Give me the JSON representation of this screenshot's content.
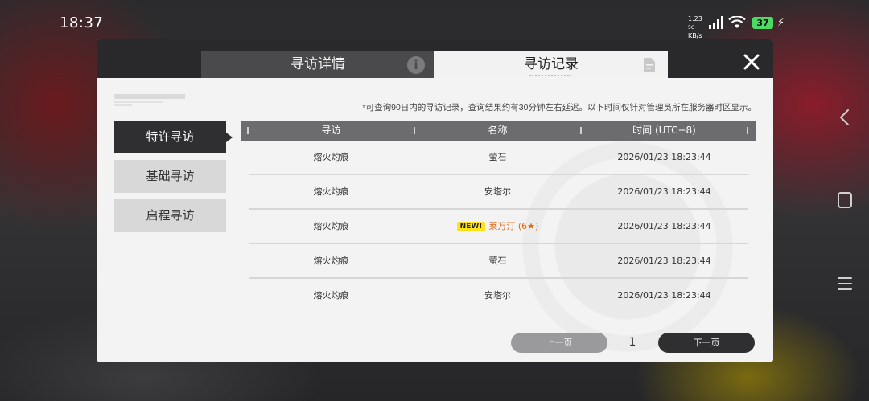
{
  "status_bar": {
    "time": "18:37",
    "net_speed_value": "1.23",
    "net_speed_unit": "KB/s",
    "net_type": "5G",
    "battery": "37",
    "icons": [
      "signal-icon",
      "wifi-icon",
      "battery-icon",
      "charging-icon"
    ]
  },
  "dialog": {
    "tabs": [
      {
        "label": "寻访详情",
        "icon": "info-icon",
        "active": false
      },
      {
        "label": "寻访记录",
        "icon": "document-icon",
        "active": true
      }
    ],
    "close_icon": "close-icon",
    "notice": "*可查询90日内的寻访记录，查询结果约有30分钟左右延迟。以下时间仅针对管理员所在服务器时区显示。",
    "sidebar": [
      {
        "label": "特许寻访",
        "active": true
      },
      {
        "label": "基础寻访",
        "active": false
      },
      {
        "label": "启程寻访",
        "active": false
      }
    ],
    "table": {
      "headers": [
        "寻访",
        "名称",
        "时间 (UTC+8)"
      ],
      "rows": [
        {
          "pool": "熔火灼痕",
          "name": "萤石",
          "time": "2026/01/23 18:23:44",
          "is_new": false,
          "badge": ""
        },
        {
          "pool": "熔火灼痕",
          "name": "安塔尔",
          "time": "2026/01/23 18:23:44",
          "is_new": false,
          "badge": ""
        },
        {
          "pool": "熔火灼痕",
          "name": "莱万汀 (6★)",
          "time": "2026/01/23 18:23:44",
          "is_new": true,
          "badge": "NEW!"
        },
        {
          "pool": "熔火灼痕",
          "name": "萤石",
          "time": "2026/01/23 18:23:44",
          "is_new": false,
          "badge": ""
        },
        {
          "pool": "熔火灼痕",
          "name": "安塔尔",
          "time": "2026/01/23 18:23:44",
          "is_new": false,
          "badge": ""
        }
      ]
    },
    "pagination": {
      "prev_label": "上一页",
      "page": "1",
      "next_label": "下一页"
    }
  },
  "colors": {
    "header_dark": "#29292b",
    "highlight_orange": "#e06a14",
    "badge_yellow": "#ffe21a",
    "battery_green": "#4cd964"
  },
  "nav_bar": {
    "icons": [
      "back-icon",
      "home-icon",
      "menu-icon"
    ]
  }
}
